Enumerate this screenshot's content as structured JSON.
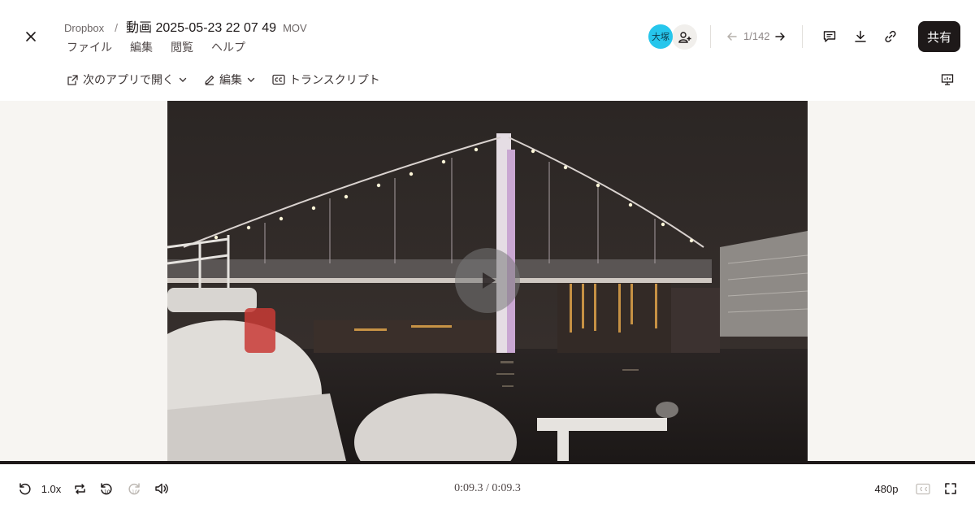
{
  "header": {
    "breadcrumb_root": "Dropbox",
    "breadcrumb_sep": "/",
    "file_title": "動画 2025-05-23 22 07 49",
    "file_ext": "MOV",
    "menu": [
      "ファイル",
      "編集",
      "閲覧",
      "ヘルプ"
    ],
    "avatar_initials": "大塚",
    "pager": "1/142",
    "share_label": "共有"
  },
  "toolbar": {
    "open_with_label": "次のアプリで開く",
    "edit_label": "編集",
    "transcript_label": "トランスクリプト"
  },
  "player": {
    "speed": "1.0x",
    "timecode": "0:09.3 / 0:09.3",
    "quality": "480p",
    "progress": 1.0
  },
  "icons": {
    "close": "close-icon",
    "add_member": "add-member-icon",
    "prev": "arrow-left-icon",
    "next": "arrow-right-icon",
    "comment": "comment-icon",
    "download": "download-icon",
    "link": "link-icon",
    "open_external": "open-external-icon",
    "pencil": "pencil-icon",
    "cc": "closed-caption-icon",
    "present": "present-icon",
    "replay": "replay-icon",
    "loop": "loop-icon",
    "rewind10": "rewind-10-icon",
    "forward10": "forward-10-icon",
    "volume": "volume-icon",
    "fullscreen": "fullscreen-icon",
    "play": "play-icon"
  },
  "colors": {
    "accent_avatar": "#26c6ec",
    "share_button": "#1e1919",
    "stage_background": "#f7f5f2"
  }
}
